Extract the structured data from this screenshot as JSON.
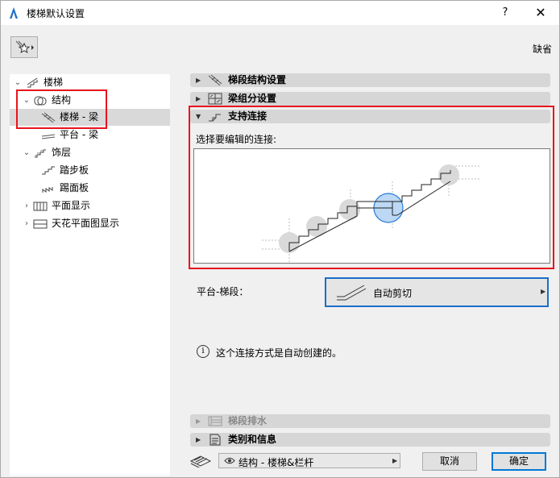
{
  "window": {
    "title": "楼梯默认设置",
    "help_label": "?",
    "close_label": "✕",
    "default_label": "缺省"
  },
  "tree": {
    "items": [
      {
        "label": "楼梯",
        "icon": "stair-icon",
        "expanded": true
      },
      {
        "label": "结构",
        "icon": "structure-icon",
        "expanded": true
      },
      {
        "label": "楼梯 - 梁",
        "icon": "stair-beam-icon",
        "selected": true
      },
      {
        "label": "平台 - 梁",
        "icon": "landing-beam-icon"
      },
      {
        "label": "饰层",
        "icon": "finish-icon",
        "expanded": true
      },
      {
        "label": "踏步板",
        "icon": "tread-icon"
      },
      {
        "label": "踢面板",
        "icon": "riser-icon"
      },
      {
        "label": "平面显示",
        "icon": "floor-plan-icon",
        "expanded": false
      },
      {
        "label": "天花平面图显示",
        "icon": "ceiling-plan-icon",
        "expanded": false
      }
    ]
  },
  "sections": {
    "flight_structure": "梯段结构设置",
    "beam_segment": "梁组分设置",
    "support_connection": "支持连接",
    "flight_drainage": "梯段排水",
    "classification": "类别和信息"
  },
  "connection": {
    "prompt": "选择要编辑的连接:",
    "platform_flight_label": "平台-梯段：",
    "cut_mode": "自动剪切",
    "info_text": "这个连接方式是自动创建的。"
  },
  "bottom": {
    "layer_value": "结构 - 楼梯&栏杆",
    "cancel_label": "取消",
    "ok_label": "确定"
  },
  "colors": {
    "highlight_red": "#e8141d",
    "focus_blue": "#1a6fc9",
    "selected_circle": "#bcd8f4"
  }
}
